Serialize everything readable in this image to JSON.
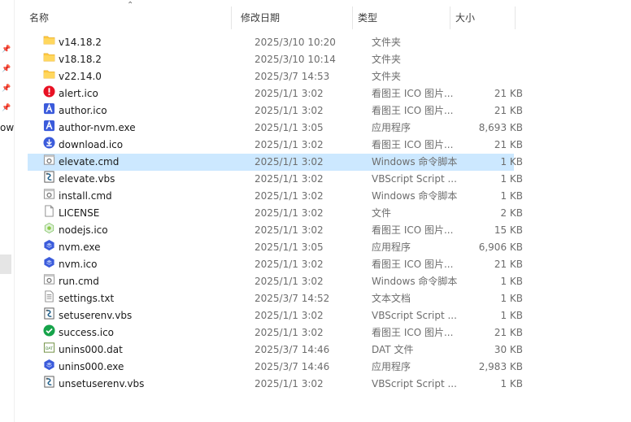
{
  "nav": {
    "truncated_label": "ow"
  },
  "columns": {
    "name": "名称",
    "date": "修改日期",
    "type": "类型",
    "size": "大小"
  },
  "files": [
    {
      "name": "v14.18.2",
      "date": "2025/3/10 10:20",
      "type": "文件夹",
      "size": "",
      "icon": "folder-icon"
    },
    {
      "name": "v18.18.2",
      "date": "2025/3/10 10:14",
      "type": "文件夹",
      "size": "",
      "icon": "folder-icon"
    },
    {
      "name": "v22.14.0",
      "date": "2025/3/7 14:53",
      "type": "文件夹",
      "size": "",
      "icon": "folder-icon"
    },
    {
      "name": "alert.ico",
      "date": "2025/1/1 3:02",
      "type": "看图王 ICO 图片...",
      "size": "21 KB",
      "icon": "alert-icon"
    },
    {
      "name": "author.ico",
      "date": "2025/1/1 3:02",
      "type": "看图王 ICO 图片...",
      "size": "21 KB",
      "icon": "author-icon"
    },
    {
      "name": "author-nvm.exe",
      "date": "2025/1/1 3:05",
      "type": "应用程序",
      "size": "8,693 KB",
      "icon": "author-icon"
    },
    {
      "name": "download.ico",
      "date": "2025/1/1 3:02",
      "type": "看图王 ICO 图片...",
      "size": "21 KB",
      "icon": "download-icon"
    },
    {
      "name": "elevate.cmd",
      "date": "2025/1/1 3:02",
      "type": "Windows 命令脚本",
      "size": "1 KB",
      "icon": "cmd-file-icon"
    },
    {
      "name": "elevate.vbs",
      "date": "2025/1/1 3:02",
      "type": "VBScript Script ...",
      "size": "1 KB",
      "icon": "vbs-file-icon"
    },
    {
      "name": "install.cmd",
      "date": "2025/1/1 3:02",
      "type": "Windows 命令脚本",
      "size": "1 KB",
      "icon": "cmd-file-icon"
    },
    {
      "name": "LICENSE",
      "date": "2025/1/1 3:02",
      "type": "文件",
      "size": "2 KB",
      "icon": "blank-file-icon"
    },
    {
      "name": "nodejs.ico",
      "date": "2025/1/1 3:02",
      "type": "看图王 ICO 图片...",
      "size": "15 KB",
      "icon": "nodejs-icon"
    },
    {
      "name": "nvm.exe",
      "date": "2025/1/1 3:05",
      "type": "应用程序",
      "size": "6,906 KB",
      "icon": "nvm-icon"
    },
    {
      "name": "nvm.ico",
      "date": "2025/1/1 3:02",
      "type": "看图王 ICO 图片...",
      "size": "21 KB",
      "icon": "nvm-icon"
    },
    {
      "name": "run.cmd",
      "date": "2025/1/1 3:02",
      "type": "Windows 命令脚本",
      "size": "1 KB",
      "icon": "cmd-file-icon"
    },
    {
      "name": "settings.txt",
      "date": "2025/3/7 14:52",
      "type": "文本文档",
      "size": "1 KB",
      "icon": "text-file-icon"
    },
    {
      "name": "setuserenv.vbs",
      "date": "2025/1/1 3:02",
      "type": "VBScript Script ...",
      "size": "1 KB",
      "icon": "vbs-file-icon"
    },
    {
      "name": "success.ico",
      "date": "2025/1/1 3:02",
      "type": "看图王 ICO 图片...",
      "size": "21 KB",
      "icon": "success-icon"
    },
    {
      "name": "unins000.dat",
      "date": "2025/3/7 14:46",
      "type": "DAT 文件",
      "size": "30 KB",
      "icon": "dat-file-icon"
    },
    {
      "name": "unins000.exe",
      "date": "2025/3/7 14:46",
      "type": "应用程序",
      "size": "2,983 KB",
      "icon": "nvm-icon"
    },
    {
      "name": "unsetuserenv.vbs",
      "date": "2025/1/1 3:02",
      "type": "VBScript Script ...",
      "size": "1 KB",
      "icon": "vbs-file-icon"
    }
  ],
  "selected_index": 7,
  "colors": {
    "selection": "#cce8ff",
    "folder": "#ffc83d",
    "alert": "#e81123",
    "success": "#16a34a",
    "nvm": "#3b5bdb"
  }
}
